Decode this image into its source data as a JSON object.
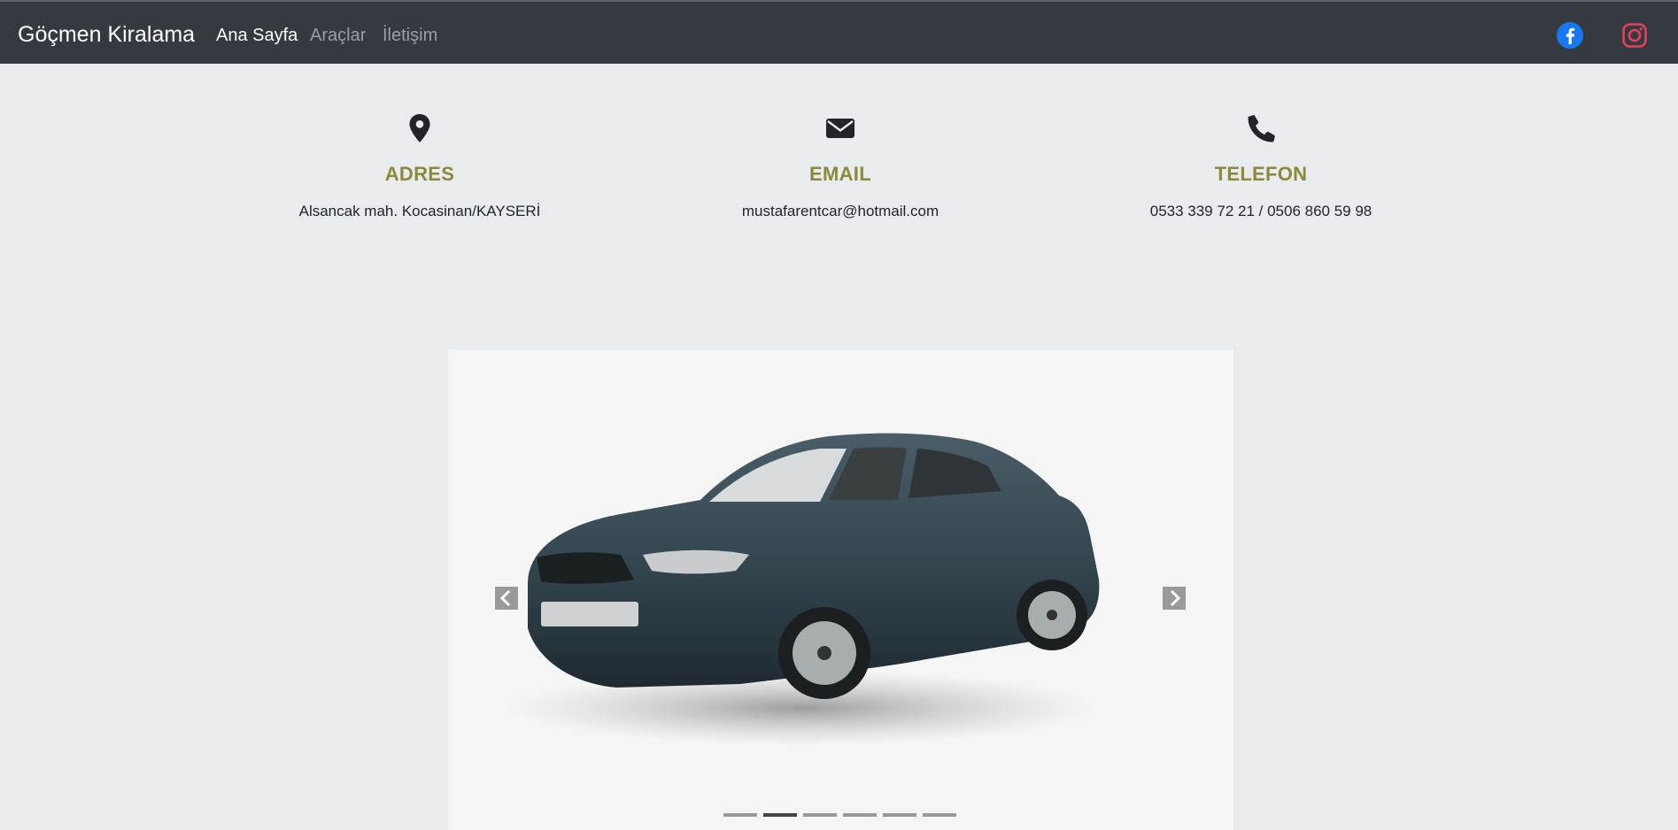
{
  "navbar": {
    "brand": "Göçmen Kiralama",
    "links": [
      {
        "label": "Ana Sayfa",
        "active": true
      },
      {
        "label": "Araçlar",
        "active": false
      },
      {
        "label": "İletişim",
        "active": false
      }
    ],
    "social": [
      {
        "icon": "facebook-icon",
        "color": "#1877f2"
      },
      {
        "icon": "instagram-icon",
        "color": "#e4405f"
      }
    ]
  },
  "contact": {
    "adres": {
      "icon": "map-pin-icon",
      "title": "ADRES",
      "value": "Alsancak mah. Kocasinan/KAYSERİ"
    },
    "email": {
      "icon": "envelope-icon",
      "title": "EMAIL",
      "value": "mustafarentcar@hotmail.com"
    },
    "telefon": {
      "icon": "phone-icon",
      "title": "TELEFON",
      "value": "0533 339 72 21 / 0506 860 59 98"
    }
  },
  "carousel": {
    "slide_image": "car-photo",
    "slide_count": 6,
    "active_index": 1
  },
  "colors": {
    "navbar_bg": "#343a40",
    "page_bg": "#e9ecef",
    "contact_title": "#8a8a3a"
  }
}
